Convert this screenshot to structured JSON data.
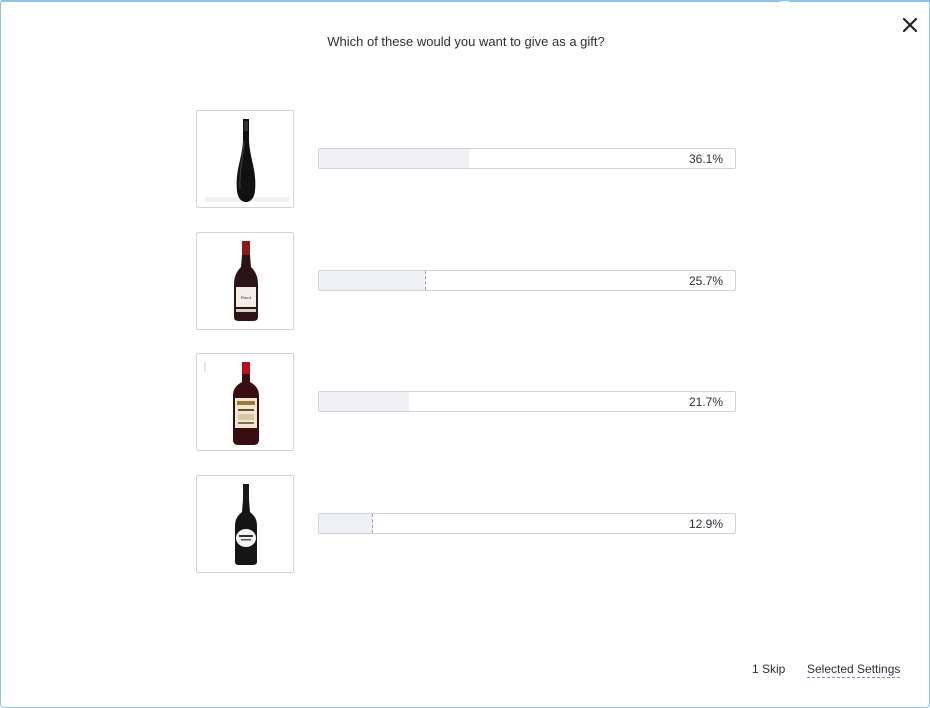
{
  "dialog": {
    "question": "Which of these would you want to give as a gift?",
    "close_icon": "close-icon"
  },
  "options": [
    {
      "image": "black-sculpted-wine-bottle",
      "percent_label": "36.1%",
      "percent": 36.1
    },
    {
      "image": "red-burgundy-wine-bottle",
      "percent_label": "25.7%",
      "percent": 25.7
    },
    {
      "image": "bordeaux-wine-bottle-cream-label",
      "percent_label": "21.7%",
      "percent": 21.7
    },
    {
      "image": "dark-wine-bottle-white-label",
      "percent_label": "12.9%",
      "percent": 12.9
    }
  ],
  "footer": {
    "skip": "1 Skip",
    "settings": "Selected Settings"
  },
  "colors": {
    "frame_border": "#8cc4ea",
    "bar_fill": "#eef0f3",
    "bar_border": "#cfd3d8",
    "settings_underline": "#8b7fc7"
  }
}
